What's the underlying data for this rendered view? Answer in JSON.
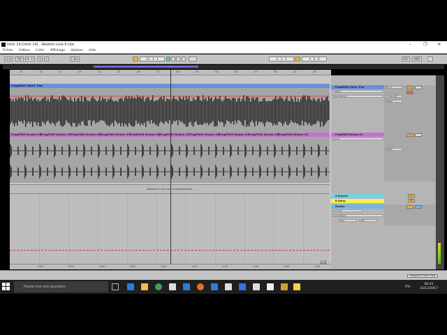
{
  "window": {
    "title": "Intro 14 [Intro 14] - Ableton Live 9 Lite",
    "min": "–",
    "max": "❐",
    "close": "✕"
  },
  "menu": [
    "Fichier",
    "Edition",
    "Créer",
    "Affichage",
    "Options",
    "Aide"
  ],
  "transport": {
    "link": "Link",
    "tap": "TAP",
    "tempo": "98.00",
    "sig1": "4",
    "sig2": "4",
    "quant": "1 Bar",
    "position": "22 . 1 . 1",
    "loop_start": "3 . 1 . 1",
    "loop_len": "4 . 0 . 0",
    "key": "KEY",
    "midi": "MIDI"
  },
  "ruler": [
    "13",
    "15",
    "17",
    "19",
    "21",
    "23",
    "25",
    "27",
    "29",
    "31",
    "33",
    "35",
    "37",
    "39",
    "41",
    "43"
  ],
  "tracks": {
    "clip1": "ProgD003 Ohrin' Pop",
    "drums_clip": "ProgF009 Drums #1",
    "drop_text": "Déposez ici les clips et périphériques",
    "page": "1/2"
  },
  "mixer": {
    "track1": "ProgD003 Ohrin' Pop",
    "track1_input": "Ext. In",
    "track1_sub": "1 Mono",
    "track1_mon": "In Auto Off",
    "track1_send": "Track Volume",
    "track1_out": "Master",
    "track1_num": "1",
    "track2": "ProgF009 Drums #1",
    "track2_sub": "Aucun",
    "track2_out": "Master",
    "track2_num": "2",
    "return_a": "A Reverb",
    "return_b": "B Delay",
    "master": "Master",
    "master_cue": "Cue Out",
    "master_tempo": "Song Tempo",
    "master_val1": "90.0",
    "master_val2": "200",
    "ret_a_letter": "A",
    "ret_b_letter": "B"
  },
  "bottom_ruler": [
    "0:20",
    "0:30",
    "0:40",
    "0:50",
    "1:00",
    "1:10",
    "1:20",
    "1:30",
    "1:40",
    "1:50"
  ],
  "status": {
    "clip": "ProgD003 Ohrin' Pop"
  },
  "taskbar": {
    "search_placeholder": "Posez-moi une question",
    "time": "00:31",
    "date": "31/12/2017",
    "lang": "FRA"
  },
  "colors": {
    "clip1": "#6a8fd8",
    "drums": "#c86fd3",
    "return_a": "#6fd3e6",
    "return_b": "#f4f05a",
    "master": "#6fb8e6",
    "accent": "#f0b030"
  }
}
